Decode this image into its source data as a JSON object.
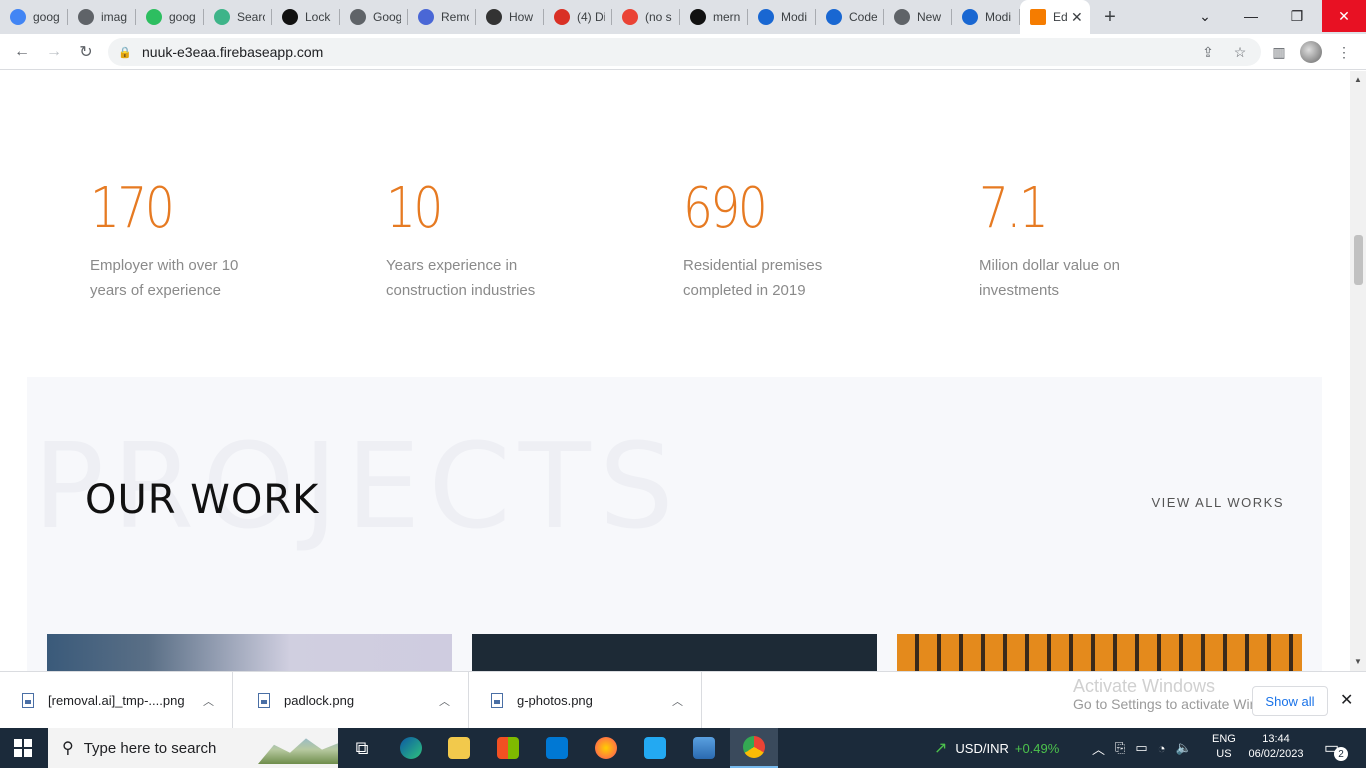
{
  "browser": {
    "tabs": [
      {
        "title": "goog",
        "color": "#4285f4",
        "icon": "google-icon"
      },
      {
        "title": "imag",
        "color": "#5f6368",
        "icon": "globe-icon"
      },
      {
        "title": "goog",
        "color": "#2dbe60",
        "icon": "bolt-icon"
      },
      {
        "title": "Searc",
        "color": "#3eb489",
        "icon": "v-icon"
      },
      {
        "title": "Lock",
        "color": "#111111",
        "icon": "st-icon"
      },
      {
        "title": "Goog",
        "color": "#5f6368",
        "icon": "globe-icon"
      },
      {
        "title": "Remo",
        "color": "#4a67d6",
        "icon": "a-icon"
      },
      {
        "title": "How",
        "color": "#333333",
        "icon": "terminal-icon"
      },
      {
        "title": "(4) Di",
        "color": "#d93025",
        "icon": "discord-icon"
      },
      {
        "title": "(no s",
        "color": "#ea4335",
        "icon": "gmail-icon"
      },
      {
        "title": "mern",
        "color": "#111111",
        "icon": "github-icon"
      },
      {
        "title": "Modi",
        "color": "#1967d2",
        "icon": "e-icon"
      },
      {
        "title": "Code",
        "color": "#1967d2",
        "icon": "c-icon"
      },
      {
        "title": "New",
        "color": "#5f6368",
        "icon": "chrome-icon"
      },
      {
        "title": "Modi",
        "color": "#1967d2",
        "icon": "e-icon"
      },
      {
        "title": "Ed",
        "color": "#f57c00",
        "icon": "orange-square-icon",
        "active": true
      }
    ],
    "new_tab": "+",
    "url": "nuuk-e3eaa.firebaseapp.com"
  },
  "stats": [
    {
      "number": "170",
      "line1": "Employer with over 10",
      "line2": "years of experience"
    },
    {
      "number": "10",
      "line1": "Years experience in",
      "line2": "construction industries"
    },
    {
      "number": "690",
      "line1": "Residential premises",
      "line2": "completed in 2019"
    },
    {
      "number": "7.1",
      "line1": "Milion dollar value on",
      "line2": "investments"
    }
  ],
  "work": {
    "bg_text": "PROJECTS",
    "title": "OUR WORK",
    "view_all": "VIEW ALL WORKS"
  },
  "downloads": {
    "items": [
      "[removal.ai]_tmp-....png",
      "padlock.png",
      "g-photos.png"
    ],
    "activate_title": "Activate Windows",
    "activate_sub": "Go to Settings to activate Windows.",
    "show_all": "Show all"
  },
  "taskbar": {
    "search_placeholder": "Type here to search",
    "fx_label": "USD/INR",
    "fx_change": "+0.49%",
    "lang_top": "ENG",
    "lang_bottom": "US",
    "time": "13:44",
    "date": "06/02/2023",
    "notif_count": "2"
  },
  "colors": {
    "accent": "#e67a22",
    "link": "#1a73e8"
  }
}
